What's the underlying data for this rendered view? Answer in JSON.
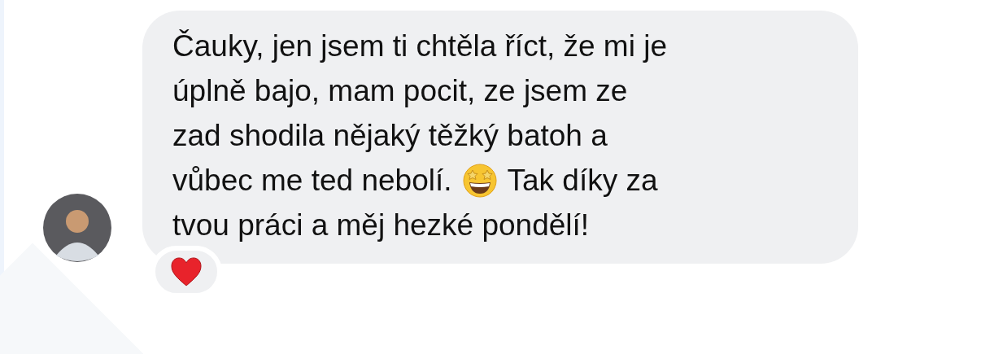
{
  "message": {
    "lines": [
      [
        {
          "kind": "text",
          "text": "Čauky, jen jsem ti chtěla říct, že mi je"
        }
      ],
      [
        {
          "kind": "text",
          "text": "úplně bajo, mam pocit, ze jsem ze"
        }
      ],
      [
        {
          "kind": "text",
          "text": "zad shodila nějaký těžký batoh a"
        }
      ],
      [
        {
          "kind": "text",
          "text": "vůbec me ted nebolí."
        },
        {
          "kind": "emoji"
        },
        {
          "kind": "text",
          "text": "Tak díky za"
        }
      ],
      [
        {
          "kind": "text",
          "text": "tvou práci a měj hezké pondělí!"
        }
      ]
    ]
  },
  "reactions": [
    {
      "kind": "heart"
    }
  ]
}
